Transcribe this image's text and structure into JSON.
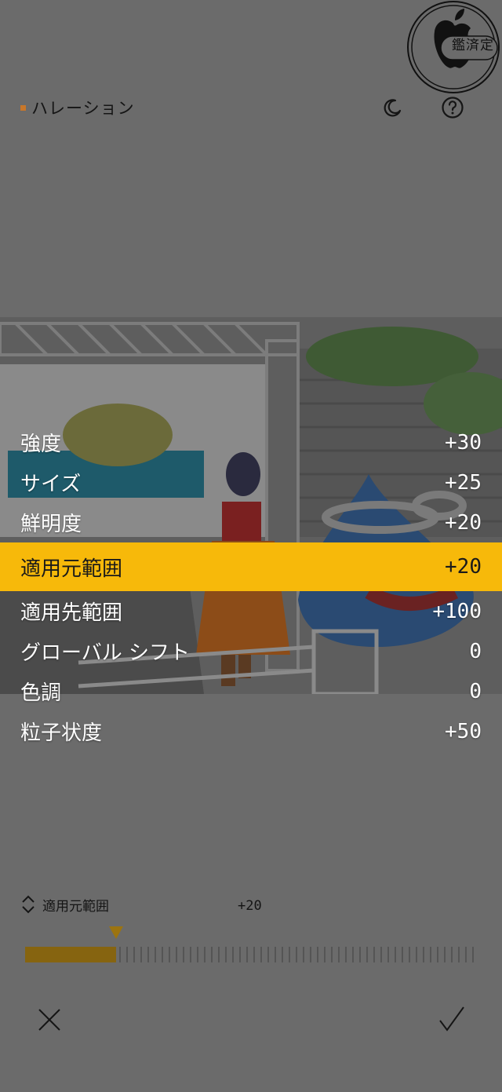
{
  "header": {
    "title": "ハレーション",
    "night_icon": "moon-icon",
    "help_icon": "question-circle-icon"
  },
  "badge": {
    "text": "鑑済定",
    "icon": "apple-logo-icon"
  },
  "params": [
    {
      "label": "強度",
      "value": "+30",
      "selected": false
    },
    {
      "label": "サイズ",
      "value": "+25",
      "selected": false
    },
    {
      "label": "鮮明度",
      "value": "+20",
      "selected": false
    },
    {
      "label": "適用元範囲",
      "value": "+20",
      "selected": true
    },
    {
      "label": "適用先範囲",
      "value": "+100",
      "selected": false
    },
    {
      "label": "グローバル シフト",
      "value": "0",
      "selected": false
    },
    {
      "label": "色調",
      "value": "0",
      "selected": false
    },
    {
      "label": "粒子状度",
      "value": "+50",
      "selected": false
    }
  ],
  "selector": {
    "label": "適用元範囲",
    "value": "+20",
    "icon": "chevron-up-down-icon"
  },
  "slider": {
    "value_fraction": 0.2
  },
  "actions": {
    "cancel_icon": "close-icon",
    "confirm_icon": "checkmark-icon"
  },
  "colors": {
    "background": "#6b6b6b",
    "accent": "#f7b90a",
    "slider_fill": "#866410"
  }
}
